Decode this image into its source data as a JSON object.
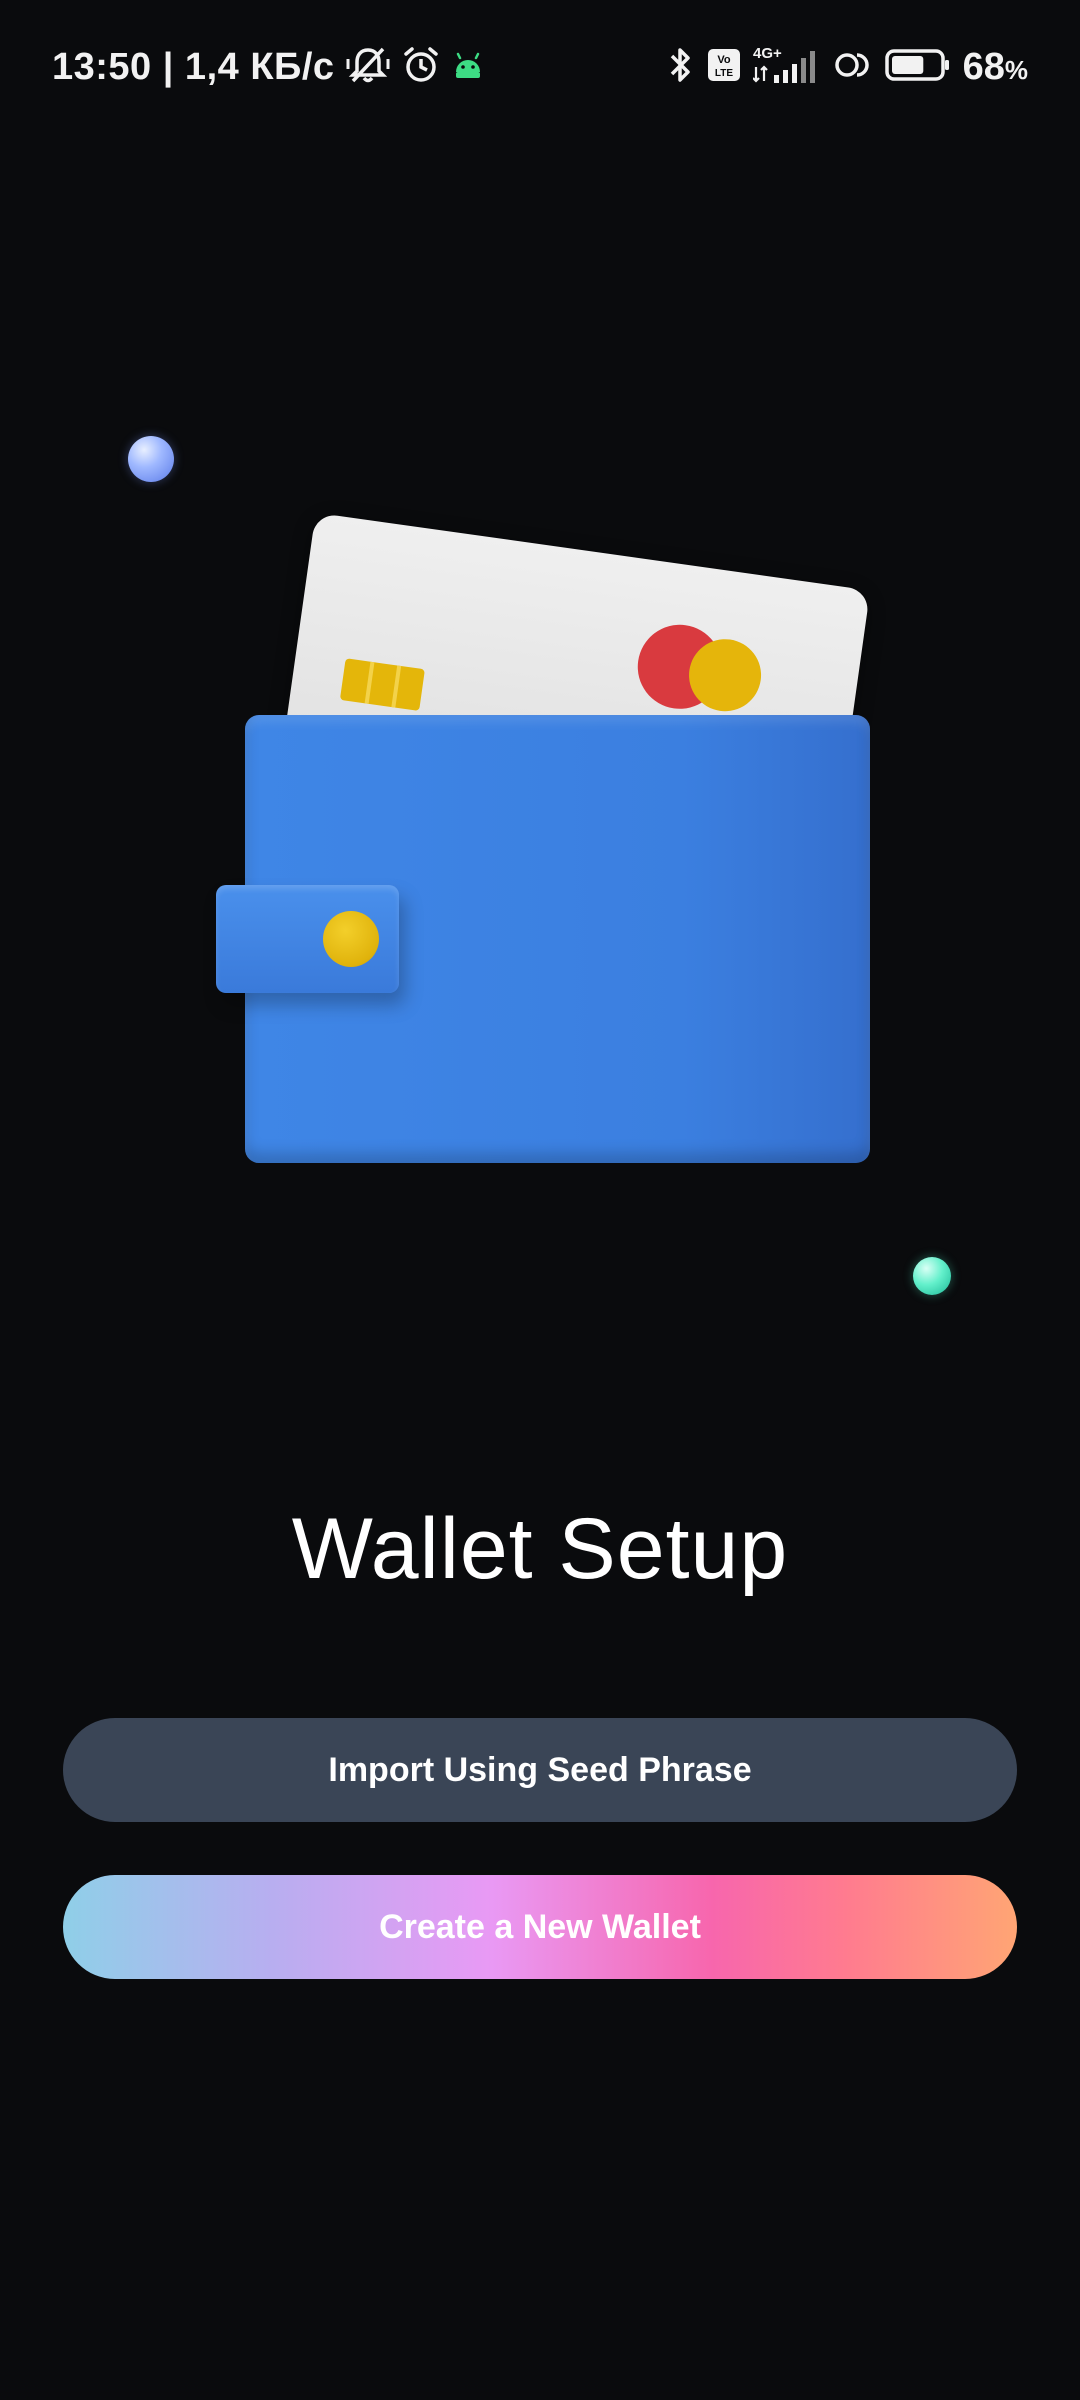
{
  "status_bar": {
    "time_and_speed": "13:50 | 1,4 КБ/с",
    "network_label": "4G+",
    "volte_label": "Vo LTE",
    "battery_percent": "68",
    "battery_unit": "%",
    "battery_level": 0.68,
    "icons": [
      "muted-bell-icon",
      "alarm-icon",
      "android-icon",
      "bluetooth-icon",
      "volte-icon",
      "signal-icon",
      "hotspot-icon",
      "battery-icon"
    ]
  },
  "illustration": {
    "colors": {
      "wallet": "#3b7fe0",
      "card": "#e6e6e6",
      "clasp": "#e0b30c",
      "orb_blue": "#9fb8ff",
      "orb_teal": "#63f0cb"
    }
  },
  "main": {
    "title": "Wallet Setup",
    "import_button_label": "Import Using Seed Phrase",
    "create_button_label": "Create a New Wallet"
  },
  "colors": {
    "background": "#0a0b0d",
    "import_button": "#3a4556",
    "create_gradient": [
      "#8fcfe8",
      "#e999f4",
      "#f766ad",
      "#ffa574"
    ]
  }
}
